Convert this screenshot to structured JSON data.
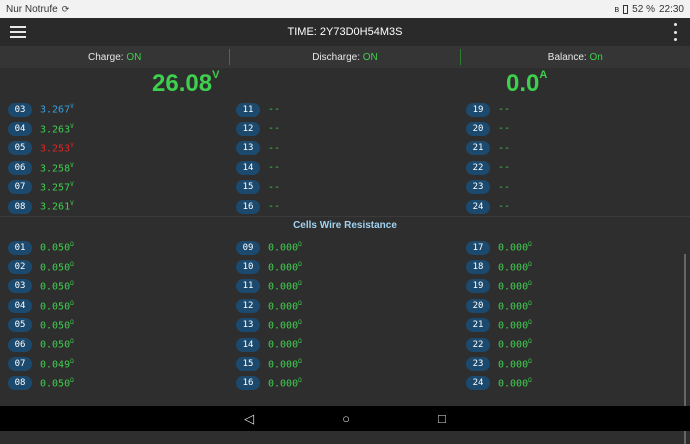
{
  "status": {
    "carrier": "Nur Notrufe",
    "battery": "52 %",
    "time": "22:30"
  },
  "app": {
    "title": "TIME: 2Y73D0H54M3S"
  },
  "modes": [
    {
      "label": "Charge:",
      "value": "ON"
    },
    {
      "label": "Discharge:",
      "value": "ON"
    },
    {
      "label": "Balance:",
      "value": "On"
    }
  ],
  "voltage": {
    "value": "26.08",
    "unit": "V"
  },
  "current": {
    "value": "0.0",
    "unit": "A"
  },
  "cells": {
    "columns": [
      [
        {
          "id": "03",
          "value": "3.267",
          "unit": "V",
          "style": "blue"
        },
        {
          "id": "04",
          "value": "3.263",
          "unit": "V",
          "style": "green"
        },
        {
          "id": "05",
          "value": "3.253",
          "unit": "V",
          "style": "red"
        },
        {
          "id": "06",
          "value": "3.258",
          "unit": "V",
          "style": "green"
        },
        {
          "id": "07",
          "value": "3.257",
          "unit": "V",
          "style": "green"
        },
        {
          "id": "08",
          "value": "3.261",
          "unit": "V",
          "style": "green"
        }
      ],
      [
        {
          "id": "11",
          "value": "--",
          "unit": "",
          "style": "green"
        },
        {
          "id": "12",
          "value": "--",
          "unit": "",
          "style": "green"
        },
        {
          "id": "13",
          "value": "--",
          "unit": "",
          "style": "green"
        },
        {
          "id": "14",
          "value": "--",
          "unit": "",
          "style": "green"
        },
        {
          "id": "15",
          "value": "--",
          "unit": "",
          "style": "green"
        },
        {
          "id": "16",
          "value": "--",
          "unit": "",
          "style": "green"
        }
      ],
      [
        {
          "id": "19",
          "value": "--",
          "unit": "",
          "style": "green"
        },
        {
          "id": "20",
          "value": "--",
          "unit": "",
          "style": "green"
        },
        {
          "id": "21",
          "value": "--",
          "unit": "",
          "style": "green"
        },
        {
          "id": "22",
          "value": "--",
          "unit": "",
          "style": "green"
        },
        {
          "id": "23",
          "value": "--",
          "unit": "",
          "style": "green"
        },
        {
          "id": "24",
          "value": "--",
          "unit": "",
          "style": "green"
        }
      ]
    ]
  },
  "resistance": {
    "title": "Cells Wire Resistance",
    "columns": [
      [
        {
          "id": "01",
          "value": "0.050",
          "unit": "Ω"
        },
        {
          "id": "02",
          "value": "0.050",
          "unit": "Ω"
        },
        {
          "id": "03",
          "value": "0.050",
          "unit": "Ω"
        },
        {
          "id": "04",
          "value": "0.050",
          "unit": "Ω"
        },
        {
          "id": "05",
          "value": "0.050",
          "unit": "Ω"
        },
        {
          "id": "06",
          "value": "0.050",
          "unit": "Ω"
        },
        {
          "id": "07",
          "value": "0.049",
          "unit": "Ω"
        },
        {
          "id": "08",
          "value": "0.050",
          "unit": "Ω"
        }
      ],
      [
        {
          "id": "09",
          "value": "0.000",
          "unit": "Ω"
        },
        {
          "id": "10",
          "value": "0.000",
          "unit": "Ω"
        },
        {
          "id": "11",
          "value": "0.000",
          "unit": "Ω"
        },
        {
          "id": "12",
          "value": "0.000",
          "unit": "Ω"
        },
        {
          "id": "13",
          "value": "0.000",
          "unit": "Ω"
        },
        {
          "id": "14",
          "value": "0.000",
          "unit": "Ω"
        },
        {
          "id": "15",
          "value": "0.000",
          "unit": "Ω"
        },
        {
          "id": "16",
          "value": "0.000",
          "unit": "Ω"
        }
      ],
      [
        {
          "id": "17",
          "value": "0.000",
          "unit": "Ω"
        },
        {
          "id": "18",
          "value": "0.000",
          "unit": "Ω"
        },
        {
          "id": "19",
          "value": "0.000",
          "unit": "Ω"
        },
        {
          "id": "20",
          "value": "0.000",
          "unit": "Ω"
        },
        {
          "id": "21",
          "value": "0.000",
          "unit": "Ω"
        },
        {
          "id": "22",
          "value": "0.000",
          "unit": "Ω"
        },
        {
          "id": "23",
          "value": "0.000",
          "unit": "Ω"
        },
        {
          "id": "24",
          "value": "0.000",
          "unit": "Ω"
        }
      ]
    ]
  },
  "colors": {
    "green": "#3fcf4f",
    "blue": "#3aa0e0",
    "red": "#e02424",
    "pill": "#1c4a6e"
  },
  "icons": {
    "nav_back": "back-icon",
    "nav_home": "home-icon",
    "nav_recent": "recent-apps-icon"
  }
}
